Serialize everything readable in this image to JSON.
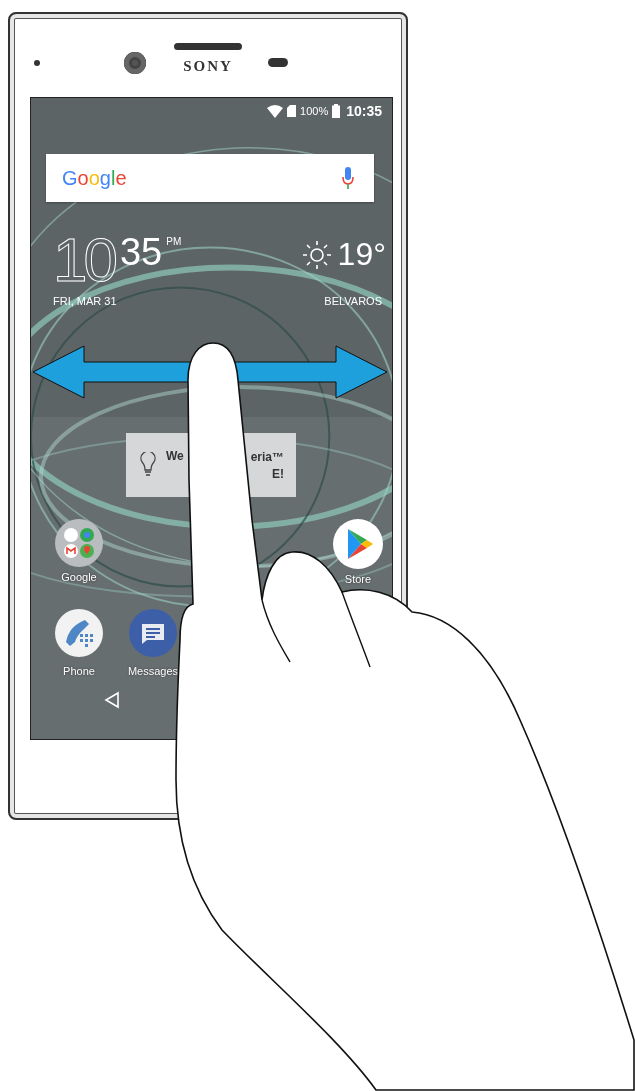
{
  "phone": {
    "brand": "SONY"
  },
  "status_bar": {
    "battery": "100%",
    "time": "10:35"
  },
  "search": {
    "logo": "Google"
  },
  "clock": {
    "hour": "10",
    "minute": "35",
    "ampm": "PM",
    "date": "FRI, MAR 31"
  },
  "weather": {
    "temperature": "19°",
    "location": "BELVAROS"
  },
  "welcome_card": {
    "text_left": "We",
    "text_right": "eria™",
    "text_right_2": "E!"
  },
  "home_apps": [
    {
      "label": "Google",
      "kind": "folder"
    },
    {
      "label": "Store",
      "kind": "play"
    }
  ],
  "dock_apps": [
    {
      "label": "Phone",
      "kind": "phone"
    },
    {
      "label": "Messages",
      "kind": "messages"
    }
  ]
}
